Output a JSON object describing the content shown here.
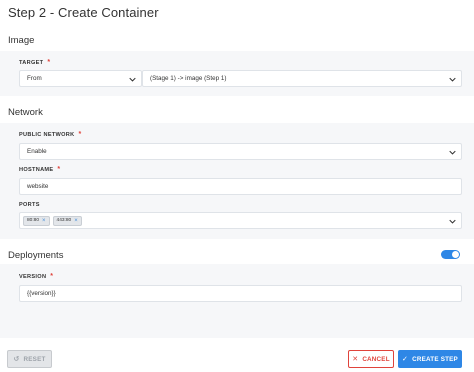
{
  "page": {
    "title": "Step 2 - Create Container"
  },
  "image_section": {
    "title": "Image",
    "target": {
      "label": "TARGET",
      "required": "*",
      "source_value": "From",
      "image_value": "(Stage 1) -> image (Step 1)"
    }
  },
  "network_section": {
    "title": "Network",
    "public_network": {
      "label": "PUBLIC NETWORK",
      "required": "*",
      "value": "Enable"
    },
    "hostname": {
      "label": "HOSTNAME",
      "required": "*",
      "value": "website"
    },
    "ports": {
      "label": "PORTS",
      "chips": [
        "80:80",
        "443:80"
      ],
      "remove_glyph": "×"
    }
  },
  "deployments_section": {
    "title": "Deployments",
    "enabled": true,
    "version": {
      "label": "VERSION",
      "required": "*",
      "value": "{{version}}"
    }
  },
  "footer": {
    "reset_label": "RESET",
    "cancel_label": "CANCEL",
    "create_label": "CREATE STEP"
  },
  "colors": {
    "accent": "#2e87e6",
    "danger": "#e0433b",
    "section_bg": "#f6f7f9"
  },
  "icons": [
    "chevron-down-icon",
    "reset-icon",
    "close-icon",
    "check-icon"
  ]
}
